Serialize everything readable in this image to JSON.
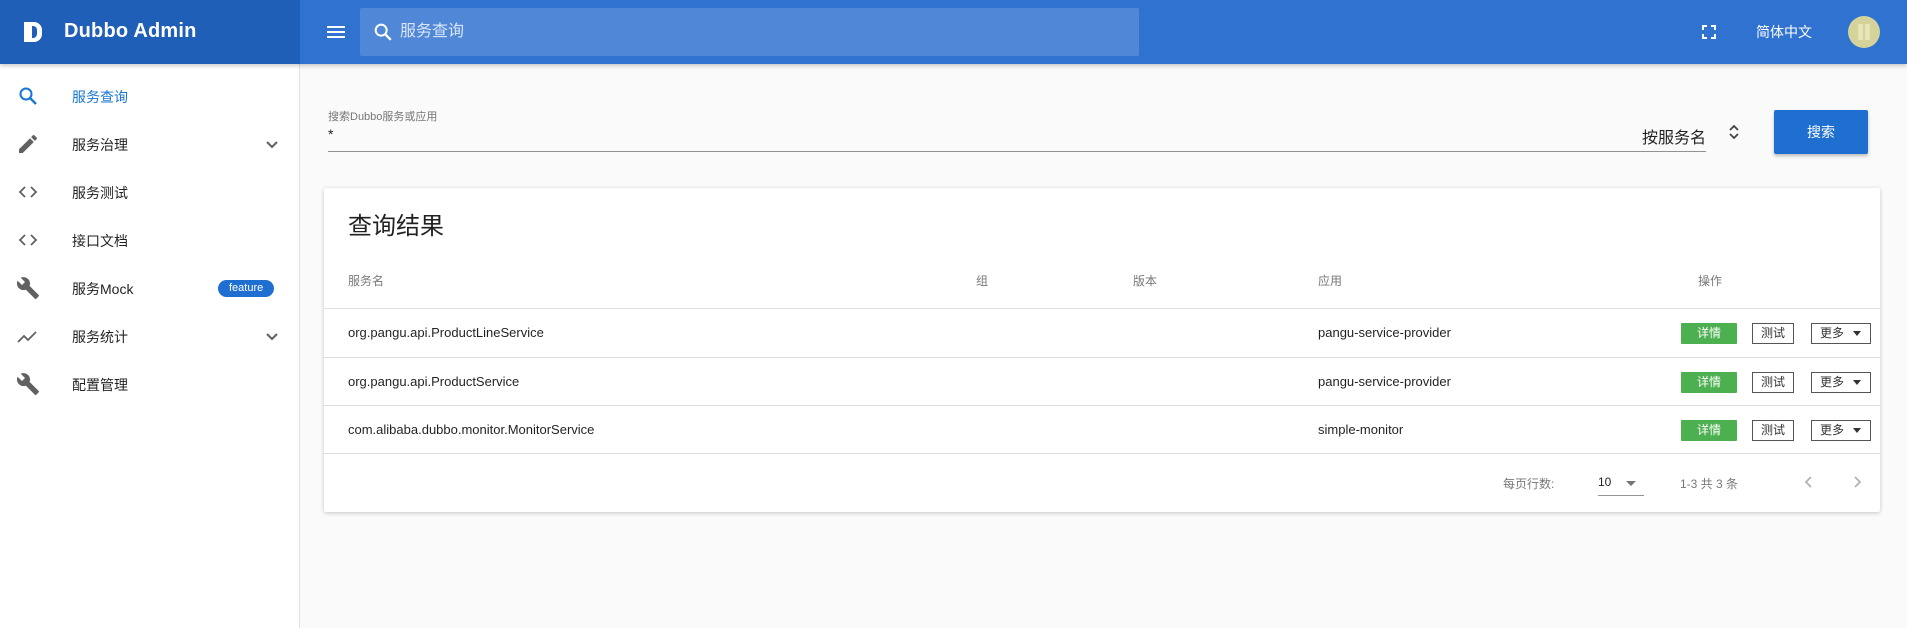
{
  "header": {
    "app_title": "Dubbo Admin",
    "search_placeholder": "服务查询",
    "language": "简体中文",
    "icons": {
      "logo": "dubbo-logo-icon",
      "menu": "hamburger-menu-icon",
      "search": "search-icon",
      "fullscreen": "fullscreen-icon",
      "avatar": "user-avatar"
    }
  },
  "colors": {
    "appbar": "#2f72d0",
    "brand": "#1f5fb7",
    "primary": "#1f6fd1",
    "success": "#4caf50"
  },
  "sidebar": {
    "items": [
      {
        "label": "服务查询",
        "icon": "search-icon",
        "active": true
      },
      {
        "label": "服务治理",
        "icon": "pencil-icon",
        "expandable": true
      },
      {
        "label": "服务测试",
        "icon": "code-icon"
      },
      {
        "label": "接口文档",
        "icon": "code-icon"
      },
      {
        "label": "服务Mock",
        "icon": "wrench-icon",
        "badge": "feature"
      },
      {
        "label": "服务统计",
        "icon": "trending-up-icon",
        "expandable": true
      },
      {
        "label": "配置管理",
        "icon": "wrench-icon"
      }
    ]
  },
  "search_form": {
    "label": "搜索Dubbo服务或应用",
    "value": "*",
    "type_select": "按服务名",
    "button": "搜索"
  },
  "results": {
    "title": "查询结果",
    "columns": [
      "服务名",
      "组",
      "版本",
      "应用",
      "操作"
    ],
    "rows": [
      {
        "service": "org.pangu.api.ProductLineService",
        "group": "",
        "version": "",
        "app": "pangu-service-provider"
      },
      {
        "service": "org.pangu.api.ProductService",
        "group": "",
        "version": "",
        "app": "pangu-service-provider"
      },
      {
        "service": "com.alibaba.dubbo.monitor.MonitorService",
        "group": "",
        "version": "",
        "app": "simple-monitor"
      }
    ],
    "actions": {
      "detail": "详情",
      "test": "测试",
      "more": "更多"
    },
    "footer": {
      "rows_per_page_label": "每页行数:",
      "rows_per_page": "10",
      "range": "1-3 共 3 条"
    }
  }
}
